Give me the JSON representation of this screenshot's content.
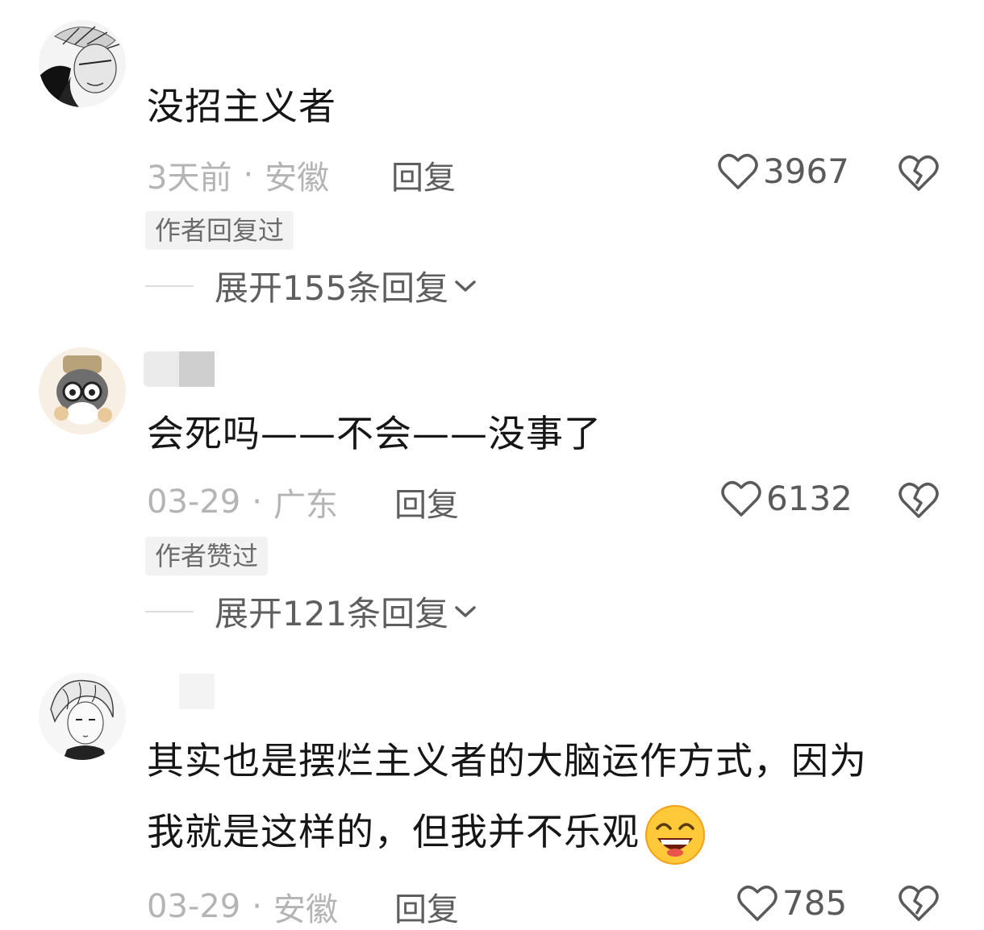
{
  "comments": [
    {
      "text": "没招主义者",
      "time": "3天前",
      "location": "安徽",
      "separator": "·",
      "reply_label": "回复",
      "likes": "3967",
      "tag": "作者回复过",
      "expand_label": "展开155条回复"
    },
    {
      "text": "会死吗——不会——没事了",
      "time": "03-29",
      "location": "广东",
      "separator": "·",
      "reply_label": "回复",
      "likes": "6132",
      "tag": "作者赞过",
      "expand_label": "展开121条回复"
    },
    {
      "text_line1": "其实也是摆烂主义者的大脑运作方式，因为",
      "text_line2": "我就是这样的，但我并不乐观",
      "time": "03-29",
      "location": "安徽",
      "separator": "·",
      "reply_label": "回复",
      "likes": "785"
    }
  ],
  "icons": {
    "like": "heart-outline-icon",
    "dislike": "broken-heart-icon",
    "expand": "chevron-down-icon",
    "emoji": "grinning-face-emoji"
  },
  "colors": {
    "text": "#161616",
    "meta": "#b4b4b4",
    "action": "#5e5e5e",
    "tag_bg": "#f2f2f2"
  }
}
